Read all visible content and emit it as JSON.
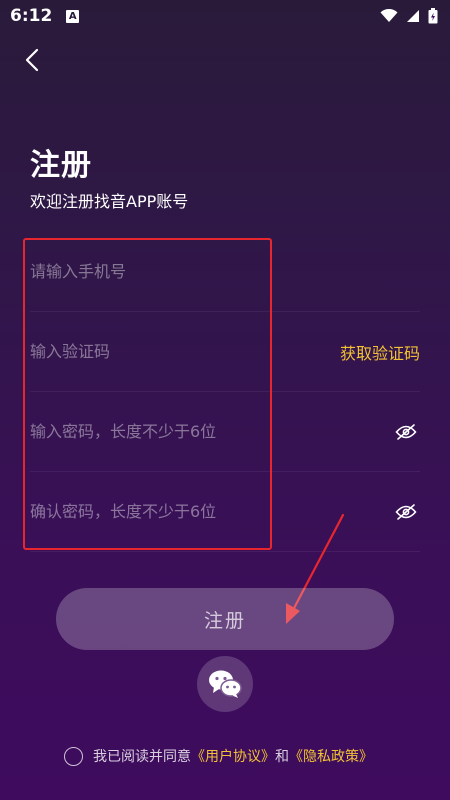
{
  "status_bar": {
    "time": "6:12",
    "notification_badge": "A"
  },
  "header": {
    "title": "注册",
    "subtitle": "欢迎注册找音APP账号"
  },
  "form": {
    "phone": {
      "placeholder": "请输入手机号",
      "value": ""
    },
    "code": {
      "placeholder": "输入验证码",
      "value": "",
      "action_label": "获取验证码"
    },
    "password": {
      "placeholder": "输入密码，长度不少于6位",
      "value": ""
    },
    "confirm_password": {
      "placeholder": "确认密码，长度不少于6位",
      "value": ""
    }
  },
  "register_button": {
    "label": "注册"
  },
  "agreement": {
    "checked": false,
    "prefix": "我已阅读并同意",
    "user_agreement": "《用户协议》",
    "conjunction": "和",
    "privacy_policy": "《隐私政策》"
  },
  "colors": {
    "accent": "#f2c234",
    "annotation": "#e8262e",
    "background_top": "#2a1a3a",
    "background_bottom": "#3f0b5e"
  },
  "icons": {
    "back": "chevron-left-icon",
    "password_visibility": "eye-off-icon",
    "social_login": "wechat-icon",
    "wifi": "wifi-icon",
    "signal": "signal-icon",
    "battery": "battery-icon"
  }
}
